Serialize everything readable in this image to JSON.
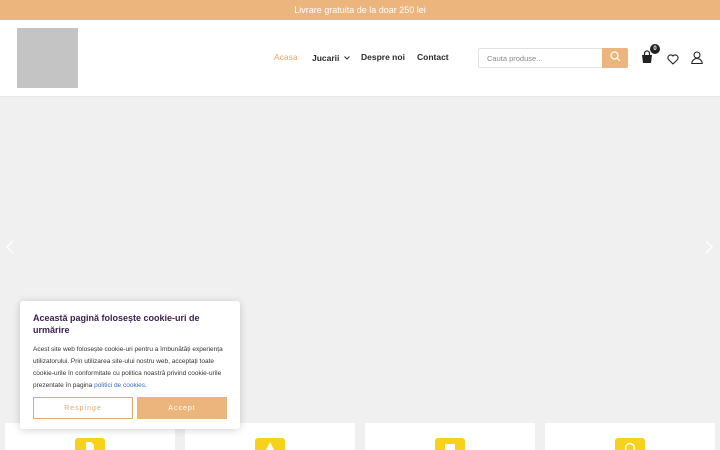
{
  "topbar": {
    "text": "Livrare gratuita de la doar 250 lei"
  },
  "header": {
    "nav": [
      {
        "label": "Acasa",
        "active": true
      },
      {
        "label": "Jucarii",
        "has_dropdown": true
      },
      {
        "label": "Despre noi"
      },
      {
        "label": "Contact"
      }
    ],
    "search": {
      "placeholder": "Cauta produse..."
    },
    "cart": {
      "count": "0"
    },
    "icons": [
      "search-icon",
      "cart-icon",
      "heart-icon",
      "user-icon"
    ]
  },
  "cookie_banner": {
    "title": "Această pagină folosește cookie-uri de urmărire",
    "body": "Acest site web folosește cookie-uri pentru a îmbunătăți experiența utilizatorului. Prin utilizarea site-ului nostru web, acceptați toate cookie-urile în conformitate cu politica noastră privind cookie-urile prezentate în pagina ",
    "link_text": "politici de cookies",
    "body_end": ".",
    "reject_label": "Respinge",
    "accept_label": "Accept"
  },
  "colors": {
    "accent": "#ebb57d",
    "topbar_bg": "#ebb57d",
    "card_icon": "#f7d21b",
    "title": "#3a1d4e"
  }
}
